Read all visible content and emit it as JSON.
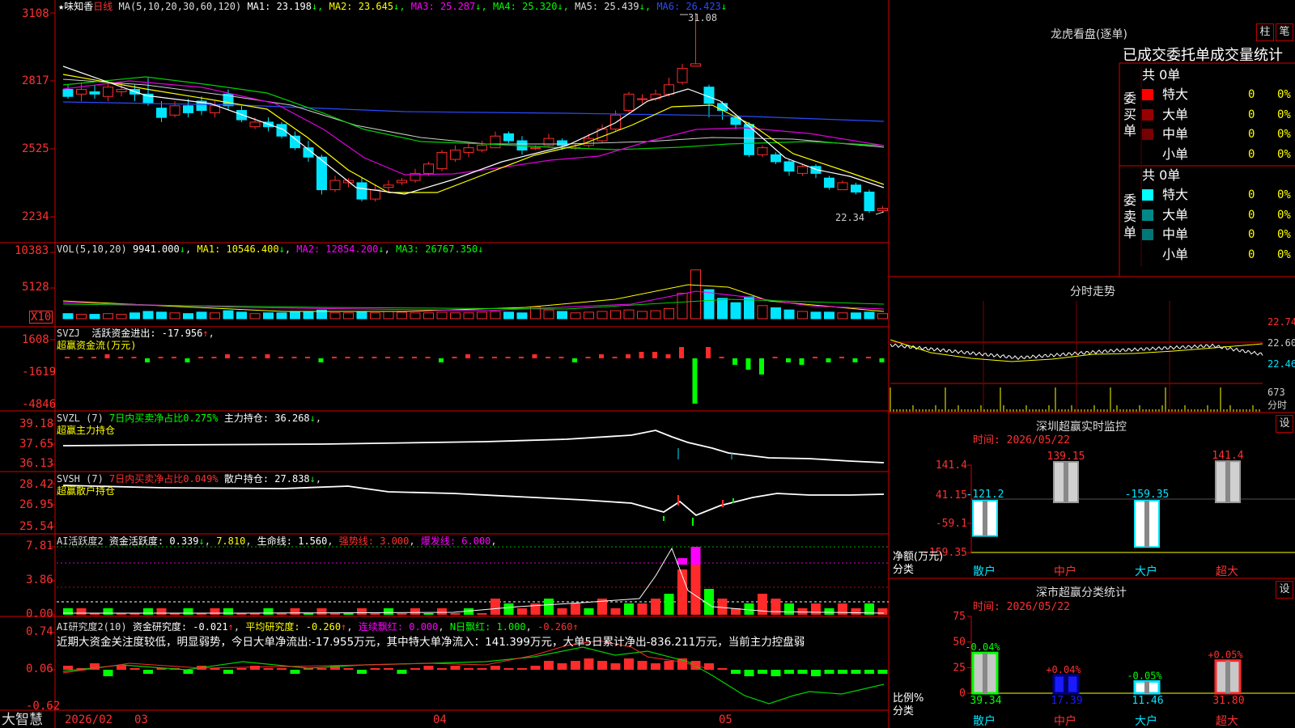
{
  "colors": {
    "bg": "#000000",
    "grid": "#b00000",
    "up": "#ff2a2a",
    "down": "#00e5ff",
    "yellow": "#ffff00",
    "white": "#ffffff",
    "magenta": "#ff00ff",
    "green": "#00ff00",
    "blue": "#4040ff"
  },
  "main": {
    "star": "★",
    "stock_name": "味知香",
    "period": "日线",
    "ma_params": "MA(5,10,20,30,60,120)",
    "ma": [
      {
        "label": "MA1: 23.198",
        "arrow": "↓",
        "color": "#ffffff"
      },
      {
        "label": "MA2: 23.645",
        "arrow": "↓",
        "color": "#ffff00"
      },
      {
        "label": "MA3: 25.287",
        "arrow": "↓",
        "color": "#ff00ff"
      },
      {
        "label": "MA4: 25.320",
        "arrow": "↓",
        "color": "#00ff00"
      },
      {
        "label": "MA5: 25.439",
        "arrow": "↓",
        "color": "#dddddd"
      },
      {
        "label": "MA6: 26.423",
        "arrow": "↓",
        "color": "#2a4bff"
      }
    ],
    "y_ticks": [
      "3108",
      "2817",
      "2525",
      "2234"
    ],
    "high_label": "31.08",
    "low_label": "22.34"
  },
  "vol": {
    "header": "VOL(5,10,20)",
    "value": "9941.000",
    "ma1": "MA1: 10546.400",
    "ma2": "MA2: 12854.200",
    "ma3": "MA3: 26767.350",
    "arrow": "↓",
    "y_ticks": [
      "10383",
      "5128"
    ],
    "unit": "X10"
  },
  "svzj": {
    "name": "SVZJ",
    "text": "活跃资金进出: -17.956",
    "arrow": "↑",
    "sub": "超赢资金流(万元)",
    "y_ticks": [
      "1608",
      "-1619",
      "-4846"
    ]
  },
  "svzl": {
    "name": "SVZL (7)",
    "ratio": "7日内买卖净占比0.275%",
    "hold": "主力持仓: 36.268",
    "arrow": "↓",
    "sub": "超赢主力持仓",
    "y_ticks": [
      "39.18",
      "37.65",
      "36.13"
    ]
  },
  "svsh": {
    "name": "SVSH (7)",
    "ratio": "7日内买卖净占比0.049%",
    "hold": "散户持仓: 27.838",
    "arrow": "↓",
    "sub": "超赢散户持仓",
    "y_ticks": [
      "28.42",
      "26.95",
      "25.54"
    ]
  },
  "ai1": {
    "name": "AI活跃度2",
    "active": "资金活跃度: 0.339",
    "a1": "↓",
    "v2": "7.810",
    "life": "生命线: 1.560",
    "strong": "强势线: 3.000",
    "burst": "爆发线: 6.000",
    "y_ticks": [
      "7.81",
      "3.86",
      "0.00"
    ]
  },
  "ai2": {
    "name": "AI研究度2(10)",
    "research": "资金研究度: -0.021",
    "avg": "平均研究度: -0.260",
    "cont": "连续飘红: 0.000",
    "nred": "N日飘红: 1.000",
    "last": "-0.260",
    "y_ticks": [
      "0.74",
      "0.06",
      "-0.62"
    ],
    "commentary": "近期大资金关注度较低，明显弱势，今日大单净流出:-17.955万元，其中特大单净流入：141.399万元，大单5日累计净出-836.211万元，当前主力控盘弱"
  },
  "footer": {
    "brand": "大智慧",
    "dates": [
      "2026/02",
      "03",
      "04",
      "05"
    ]
  },
  "dragon": {
    "title": "龙虎看盘(逐单)",
    "btn_zhu": "柱",
    "btn_bi": "笔",
    "subtitle": "已成交委托单成交量统计",
    "buy_label": "委买单",
    "sell_label": "委卖单",
    "buy_total": "共 0单",
    "sell_total": "共 0单",
    "buy_rows": [
      {
        "name": "特大",
        "count": "0",
        "pct": "0%",
        "color": "#ff0000"
      },
      {
        "name": "大单",
        "count": "0",
        "pct": "0%",
        "color": "#990000"
      },
      {
        "name": "中单",
        "count": "0",
        "pct": "0%",
        "color": "#770000"
      },
      {
        "name": "小单",
        "count": "0",
        "pct": "0%",
        "color": "#000000"
      }
    ],
    "sell_rows": [
      {
        "name": "特大",
        "count": "0",
        "pct": "0%",
        "color": "#00ffff"
      },
      {
        "name": "大单",
        "count": "0",
        "pct": "0%",
        "color": "#008888"
      },
      {
        "name": "中单",
        "count": "0",
        "pct": "0%",
        "color": "#007777"
      },
      {
        "name": "小单",
        "count": "0",
        "pct": "0%",
        "color": "#000000"
      }
    ]
  },
  "intraday": {
    "title": "分时走势",
    "y_ticks": [
      "22.74",
      "22.60",
      "22.46"
    ],
    "vol_label": "673",
    "vol_unit": "分时"
  },
  "monitor": {
    "title": "深圳超赢实时监控",
    "settings": "设",
    "time": "时间: 2026/05/22",
    "y_ticks": [
      "141.4",
      "41.15",
      "-59.1",
      "-159.35"
    ],
    "axis_label1": "净额(万元)",
    "axis_label2": "分类",
    "categories": [
      "散户",
      "中户",
      "大户",
      "超大"
    ],
    "values": [
      -121.2,
      139.15,
      -159.35,
      141.4
    ],
    "value_labels": [
      "-121.2",
      "139.15",
      "-159.35",
      "141.4"
    ]
  },
  "classify": {
    "title": "深市超赢分类统计",
    "settings": "设",
    "time": "时间: 2026/05/22",
    "y_ticks": [
      "75",
      "50",
      "25",
      "0"
    ],
    "axis_label1": "比例%",
    "axis_label2": "分类",
    "categories": [
      "散户",
      "中户",
      "大户",
      "超大"
    ],
    "values": [
      39.34,
      17.39,
      11.46,
      31.8
    ],
    "value_labels": [
      "39.34",
      "17.39",
      "11.46",
      "31.80"
    ],
    "change_labels": [
      "-0.04%",
      "+0.04%",
      "-0.05%",
      "+0.05%"
    ]
  }
}
